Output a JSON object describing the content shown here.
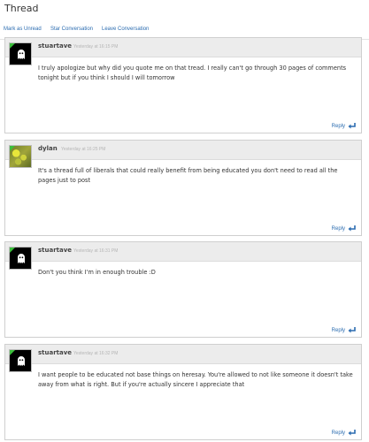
{
  "page": {
    "title": "Thread"
  },
  "actions": {
    "mark_unread": "Mark as Unread",
    "star": "Star Conversation",
    "leave": "Leave Conversation"
  },
  "messages": [
    {
      "author": "stuartave",
      "timestamp": "Yesterday at 16:15 PM",
      "text": "I truly apologize but why did you quote me on that tread. I really can't go through 30 pages of comments tonight but if you think I should I will tomorrow",
      "reply_label": "Reply",
      "avatar": "ghost-icon"
    },
    {
      "author": "dylan",
      "timestamp": "Yesterday at 16:25 PM",
      "text": "It's a thread full of liberals that could really benefit from being educated you don't need to read all the pages just to post",
      "reply_label": "Reply",
      "avatar": "photo"
    },
    {
      "author": "stuartave",
      "timestamp": "Yesterday at 16:31 PM",
      "text": "Don't you think I'm in enough trouble :D",
      "reply_label": "Reply",
      "avatar": "ghost-icon"
    },
    {
      "author": "stuartave",
      "timestamp": "Yesterday at 16:32 PM",
      "text": "I want people to be educated not base things on heresay. You're allowed to not like someone it doesn't take away from what is right. But if you're actually sincere I appreciate that",
      "reply_label": "Reply",
      "avatar": "ghost-icon"
    }
  ],
  "colors": {
    "link": "#2b6cb0",
    "header_bg": "#ececec",
    "border": "#cfcfcf",
    "avatar_badge": "#3cbf3c"
  }
}
